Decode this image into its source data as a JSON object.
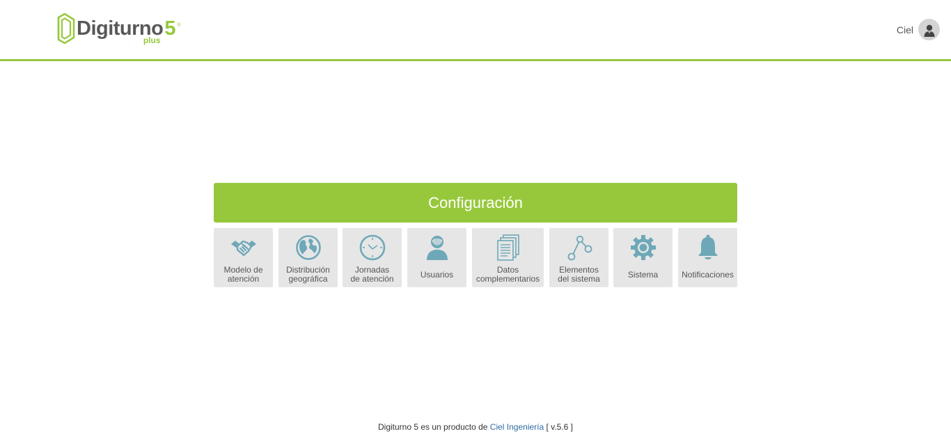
{
  "brand": {
    "word": "Digiturno",
    "number": "5",
    "registered": "®",
    "plus": "plus",
    "accent_color": "#97c83c"
  },
  "user": {
    "name": "Ciel",
    "avatar_icon": "user-avatar-icon"
  },
  "panel": {
    "title": "Configuración",
    "tiles": [
      {
        "label": "Modelo de\natención",
        "icon": "handshake-icon"
      },
      {
        "label": "Distribución\ngeográfica",
        "icon": "globe-icon"
      },
      {
        "label": "Jornadas\nde atención",
        "icon": "clock-icon"
      },
      {
        "label": "Usuarios",
        "icon": "user-icon"
      },
      {
        "label": "Datos\ncomplementarios",
        "icon": "documents-icon"
      },
      {
        "label": "Elementos\ndel sistema",
        "icon": "nodes-icon"
      },
      {
        "label": "Sistema",
        "icon": "gear-icon"
      },
      {
        "label": "Notificaciones",
        "icon": "bell-icon"
      }
    ]
  },
  "footer": {
    "prefix": "Digiturno 5 es un producto de",
    "company_link": "Ciel Ingeniería",
    "version": "[ v.5.6 ]"
  },
  "colors": {
    "tile_background": "#e6e6e6",
    "icon_color": "#6ea8b8",
    "link_color": "#2e6da4"
  }
}
